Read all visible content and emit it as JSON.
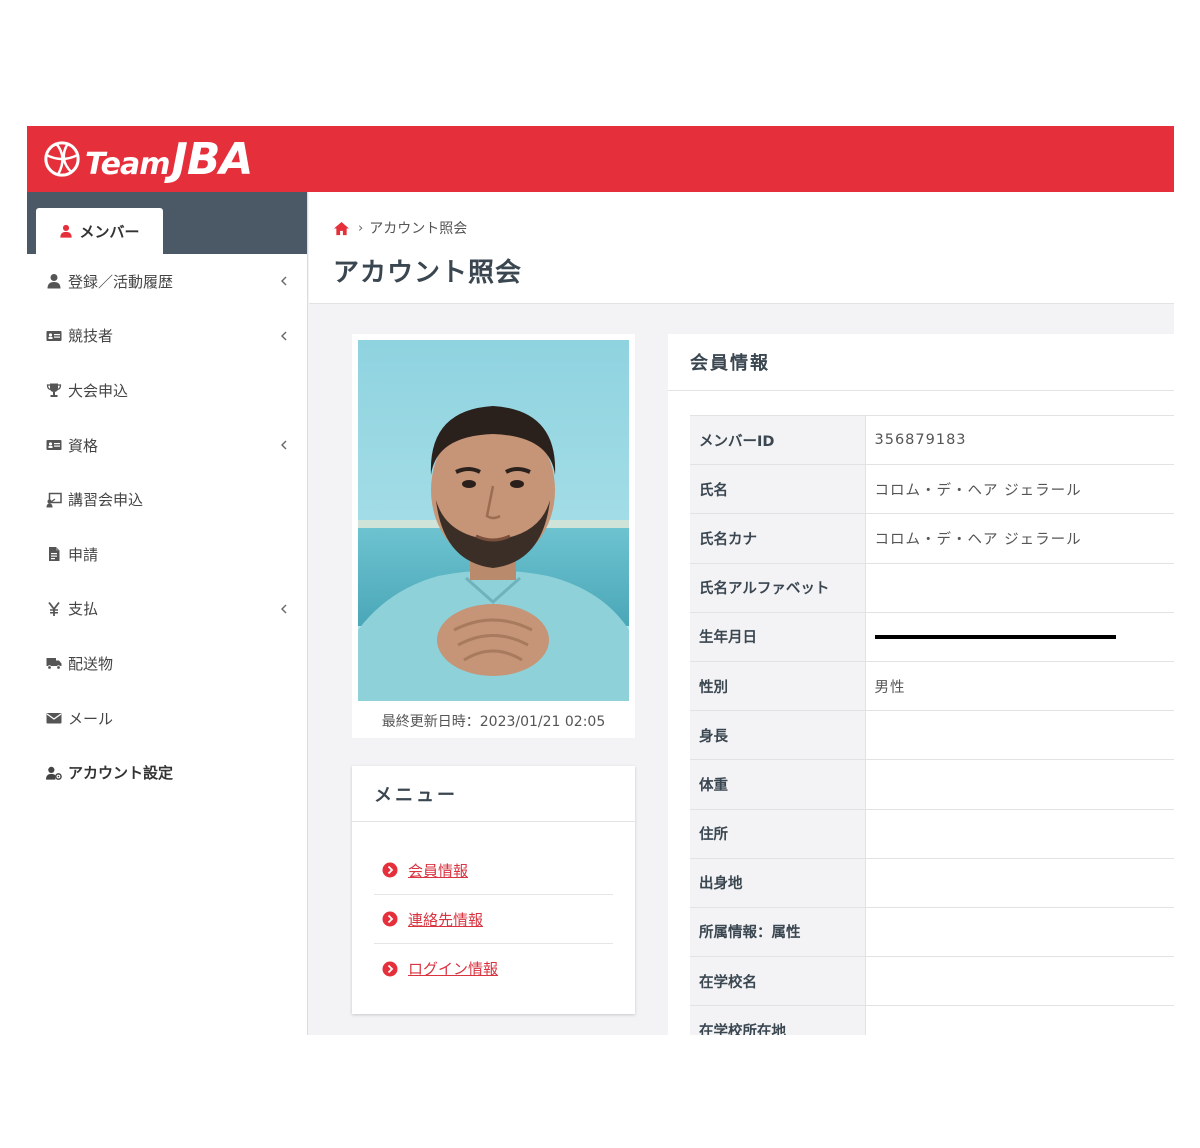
{
  "brand": {
    "team": "Team",
    "jba": "JBA"
  },
  "colors": {
    "brand_red": "#e5303b",
    "sidebar_head": "#4a5965",
    "link_red": "#d93340"
  },
  "sidebar": {
    "active_tab": {
      "label": "メンバー",
      "icon": "user-icon"
    },
    "items": [
      {
        "label": "登録／活動履歴",
        "icon": "user-icon",
        "has_submenu": true
      },
      {
        "label": "競技者",
        "icon": "id-card-icon",
        "has_submenu": true
      },
      {
        "label": "大会申込",
        "icon": "trophy-icon",
        "has_submenu": false
      },
      {
        "label": "資格",
        "icon": "id-card-icon",
        "has_submenu": true
      },
      {
        "label": "講習会申込",
        "icon": "presentation-icon",
        "has_submenu": false
      },
      {
        "label": "申請",
        "icon": "document-icon",
        "has_submenu": false
      },
      {
        "label": "支払",
        "icon": "yen-icon",
        "has_submenu": true
      },
      {
        "label": "配送物",
        "icon": "truck-icon",
        "has_submenu": false
      },
      {
        "label": "メール",
        "icon": "envelope-icon",
        "has_submenu": false
      },
      {
        "label": "アカウント設定",
        "icon": "user-gear-icon",
        "has_submenu": false
      }
    ]
  },
  "breadcrumb": {
    "current": "アカウント照会"
  },
  "page_title": "アカウント照会",
  "profile": {
    "last_updated": "最終更新日時：2023/01/21 02:05"
  },
  "menu_card": {
    "title": "メニュー",
    "links": [
      "会員情報",
      "連絡先情報",
      "ログイン情報"
    ]
  },
  "member_info": {
    "title": "会員情報",
    "rows": [
      {
        "key": "メンバーID",
        "value": "356879183"
      },
      {
        "key": "氏名",
        "value": "コロム・デ・ヘア ジェラール"
      },
      {
        "key": "氏名カナ",
        "value": "コロム・デ・ヘア ジェラール"
      },
      {
        "key": "氏名アルファベット",
        "value": ""
      },
      {
        "key": "生年月日",
        "value": "",
        "redacted": true
      },
      {
        "key": "性別",
        "value": "男性"
      },
      {
        "key": "身長",
        "value": ""
      },
      {
        "key": "体重",
        "value": ""
      },
      {
        "key": "住所",
        "value": ""
      },
      {
        "key": "出身地",
        "value": ""
      },
      {
        "key": "所属情報：属性",
        "value": ""
      },
      {
        "key": "在学校名",
        "value": ""
      },
      {
        "key": "在学校所在地",
        "value": ""
      }
    ]
  }
}
